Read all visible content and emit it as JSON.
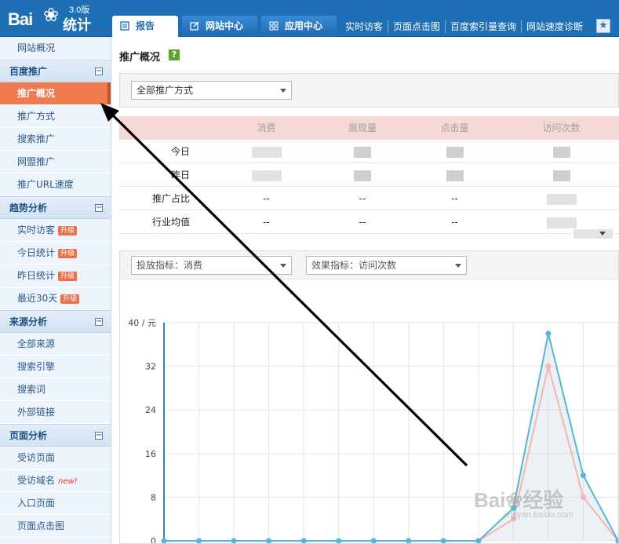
{
  "logo": {
    "brand": "Bai",
    "paw": "❀",
    "product": "统计",
    "version": "3.0版"
  },
  "tabs": [
    {
      "label": "报告",
      "active": true
    },
    {
      "label": "网站中心",
      "active": false
    },
    {
      "label": "应用中心",
      "active": false
    }
  ],
  "toplinks": [
    "实时访客",
    "页面点击图",
    "百度索引量查询",
    "网站速度诊断"
  ],
  "sidebar": {
    "top_item": "网站概况",
    "groups": [
      {
        "title": "百度推广",
        "items": [
          {
            "label": "推广概况",
            "active": true
          },
          {
            "label": "推广方式"
          },
          {
            "label": "搜索推广"
          },
          {
            "label": "网盟推广"
          },
          {
            "label": "推广URL速度"
          }
        ]
      },
      {
        "title": "趋势分析",
        "items": [
          {
            "label": "实时访客",
            "badge": "升级"
          },
          {
            "label": "今日统计",
            "badge": "升级"
          },
          {
            "label": "昨日统计",
            "badge": "升级"
          },
          {
            "label": "最近30天",
            "badge": "升级"
          }
        ]
      },
      {
        "title": "来源分析",
        "items": [
          {
            "label": "全部来源"
          },
          {
            "label": "搜索引擎"
          },
          {
            "label": "搜索词"
          },
          {
            "label": "外部链接"
          }
        ]
      },
      {
        "title": "页面分析",
        "items": [
          {
            "label": "受访页面"
          },
          {
            "label": "受访域名",
            "new": "new!"
          },
          {
            "label": "入口页面"
          },
          {
            "label": "页面点击图"
          }
        ]
      }
    ]
  },
  "main": {
    "title": "推广概况",
    "help": "?",
    "mode_select": "全部推广方式",
    "stats": {
      "headers": [
        "",
        "消费",
        "展现量",
        "点击量",
        "访问次数"
      ],
      "rows": [
        {
          "label": "今日",
          "values": [
            "",
            "",
            "",
            ""
          ]
        },
        {
          "label": "昨日",
          "values": [
            "",
            "",
            "",
            ""
          ]
        },
        {
          "label": "推广占比",
          "values": [
            "--",
            "--",
            "--",
            ""
          ]
        },
        {
          "label": "行业均值",
          "values": [
            "--",
            "--",
            "--",
            ""
          ]
        }
      ]
    },
    "metric_select": "投放指标：消费",
    "effect_select": "效果指标：访问次数"
  },
  "chart_data": {
    "type": "line",
    "y_unit_label": "40 / 元",
    "yticks": [
      "40 / 元",
      "32",
      "24",
      "16",
      "8",
      "0"
    ],
    "ylim": [
      0,
      40
    ],
    "grid": true,
    "series": [
      {
        "color": "#57b6d6",
        "values": [
          0,
          0,
          0,
          0,
          0,
          0,
          0,
          0,
          0,
          0,
          6,
          38,
          12,
          0
        ]
      },
      {
        "color": "#f0b8b0",
        "values": [
          0,
          0,
          0,
          0,
          0,
          0,
          0,
          0,
          0,
          0,
          4,
          32,
          8,
          0
        ]
      }
    ]
  },
  "watermark": {
    "text": "Bai❀经验",
    "sub": "jingyan.baidu.com"
  }
}
